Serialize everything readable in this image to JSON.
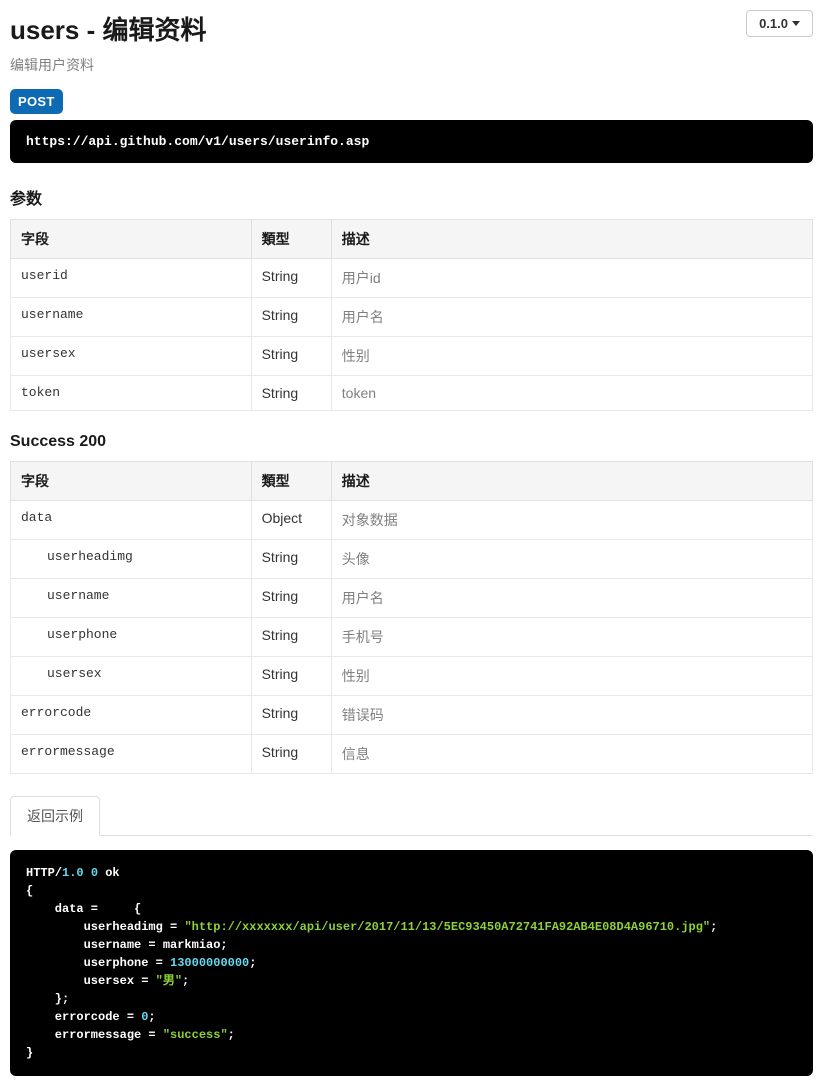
{
  "header": {
    "title": "users - 编辑资料",
    "version": "0.1.0",
    "subtitle": "编辑用户资料"
  },
  "request": {
    "method": "POST",
    "url": "https://api.github.com/v1/users/userinfo.asp"
  },
  "params": {
    "heading": "参数",
    "columns": {
      "field": "字段",
      "type": "類型",
      "desc": "描述"
    },
    "rows": [
      {
        "field": "userid",
        "type": "String",
        "desc": "用户id",
        "indent": 0
      },
      {
        "field": "username",
        "type": "String",
        "desc": "用户名",
        "indent": 0
      },
      {
        "field": "usersex",
        "type": "String",
        "desc": "性别",
        "indent": 0
      },
      {
        "field": "token",
        "type": "String",
        "desc": "token",
        "indent": 0
      }
    ]
  },
  "success": {
    "heading": "Success 200",
    "columns": {
      "field": "字段",
      "type": "類型",
      "desc": "描述"
    },
    "rows": [
      {
        "field": "data",
        "type": "Object",
        "desc": "对象数据",
        "indent": 0
      },
      {
        "field": "userheadimg",
        "type": "String",
        "desc": "头像",
        "indent": 1
      },
      {
        "field": "username",
        "type": "String",
        "desc": "用户名",
        "indent": 1
      },
      {
        "field": "userphone",
        "type": "String",
        "desc": "手机号",
        "indent": 1
      },
      {
        "field": "usersex",
        "type": "String",
        "desc": "性别",
        "indent": 1
      },
      {
        "field": "errorcode",
        "type": "String",
        "desc": "错误码",
        "indent": 0
      },
      {
        "field": "errormessage",
        "type": "String",
        "desc": "信息",
        "indent": 0
      }
    ]
  },
  "example": {
    "tab": "返回示例",
    "code": {
      "protocol": "HTTP/",
      "version": "1.0",
      "status": "0",
      "statusText": "ok",
      "body": {
        "data": {
          "userheadimg": "\"http://xxxxxxx/api/user/2017/11/13/5EC93450A72741FA92AB4E08D4A96710.jpg\"",
          "username": "markmiao",
          "userphone": "13000000000",
          "usersex": "\"男\""
        },
        "errorcode": "0",
        "errormessage": "\"success\""
      }
    }
  }
}
